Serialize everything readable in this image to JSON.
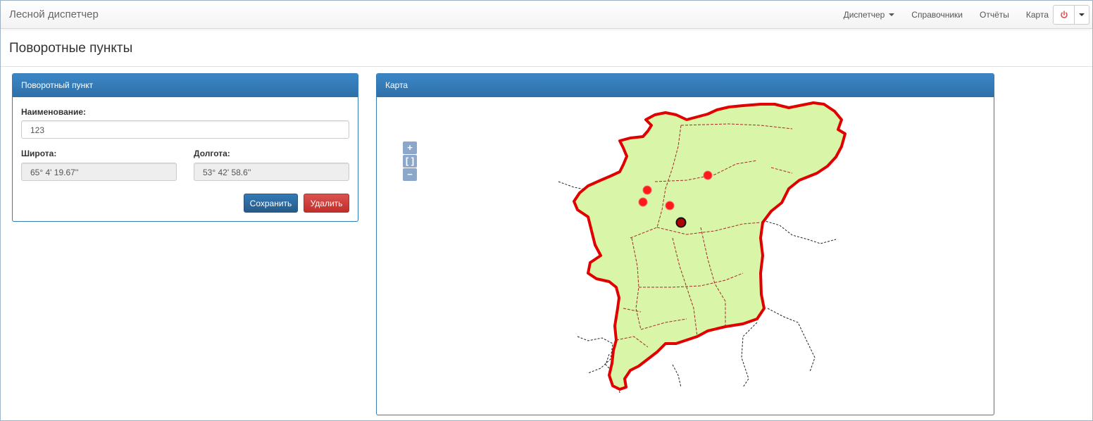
{
  "navbar": {
    "brand": "Лесной диспетчер",
    "items": [
      {
        "label": "Диспетчер",
        "dropdown": true
      },
      {
        "label": "Справочники"
      },
      {
        "label": "Отчёты"
      },
      {
        "label": "Карта"
      }
    ],
    "power_icon": "power-icon"
  },
  "page": {
    "title": "Поворотные пункты"
  },
  "form_panel": {
    "title": "Поворотный пункт",
    "name_label": "Наименование:",
    "name_value": "123",
    "lat_label": "Широта:",
    "lat_value": "65° 4' 19.67''",
    "lon_label": "Долгота:",
    "lon_value": "53° 42' 58.6''",
    "save_label": "Сохранить",
    "delete_label": "Удалить"
  },
  "map_panel": {
    "title": "Карта",
    "zoom_in": "+",
    "zoom_extent": "[ ]",
    "zoom_out": "−"
  },
  "colors": {
    "primary": "#337ab7",
    "danger": "#d9534f",
    "region_border": "#e00000",
    "region_fill": "#d8f5a8",
    "marker": "#ff1a1a",
    "selected_marker": "#b00000"
  }
}
